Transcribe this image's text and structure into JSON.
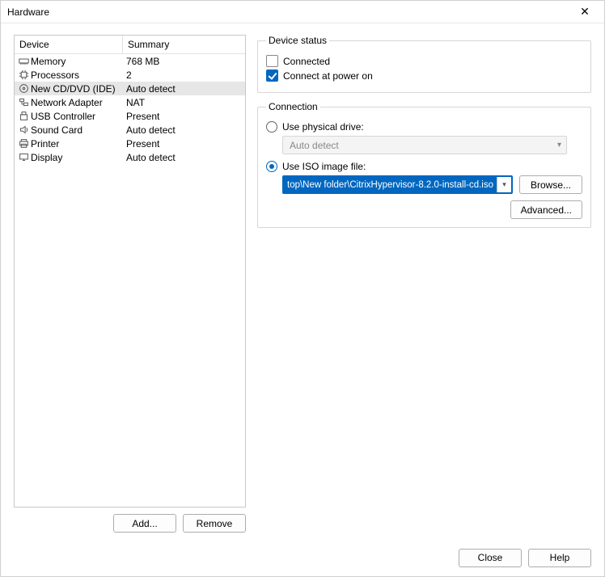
{
  "window": {
    "title": "Hardware"
  },
  "device_table": {
    "headers": {
      "device": "Device",
      "summary": "Summary"
    },
    "rows": [
      {
        "icon": "memory-icon",
        "name": "Memory",
        "summary": "768 MB",
        "selected": false
      },
      {
        "icon": "cpu-icon",
        "name": "Processors",
        "summary": "2",
        "selected": false
      },
      {
        "icon": "disc-icon",
        "name": "New CD/DVD (IDE)",
        "summary": "Auto detect",
        "selected": true
      },
      {
        "icon": "network-icon",
        "name": "Network Adapter",
        "summary": "NAT",
        "selected": false
      },
      {
        "icon": "usb-icon",
        "name": "USB Controller",
        "summary": "Present",
        "selected": false
      },
      {
        "icon": "sound-icon",
        "name": "Sound Card",
        "summary": "Auto detect",
        "selected": false
      },
      {
        "icon": "printer-icon",
        "name": "Printer",
        "summary": "Present",
        "selected": false
      },
      {
        "icon": "display-icon",
        "name": "Display",
        "summary": "Auto detect",
        "selected": false
      }
    ]
  },
  "left_buttons": {
    "add": "Add...",
    "remove": "Remove"
  },
  "device_status": {
    "legend": "Device status",
    "connected": {
      "label": "Connected",
      "checked": false
    },
    "connect_power_on": {
      "label": "Connect at power on",
      "checked": true
    }
  },
  "connection": {
    "legend": "Connection",
    "physical": {
      "label": "Use physical drive:",
      "selected": false,
      "drive_value": "Auto detect"
    },
    "iso": {
      "label": "Use ISO image file:",
      "selected": true,
      "path": "top\\New folder\\CitrixHypervisor-8.2.0-install-cd.iso"
    },
    "browse": "Browse...",
    "advanced": "Advanced..."
  },
  "footer": {
    "close": "Close",
    "help": "Help"
  }
}
